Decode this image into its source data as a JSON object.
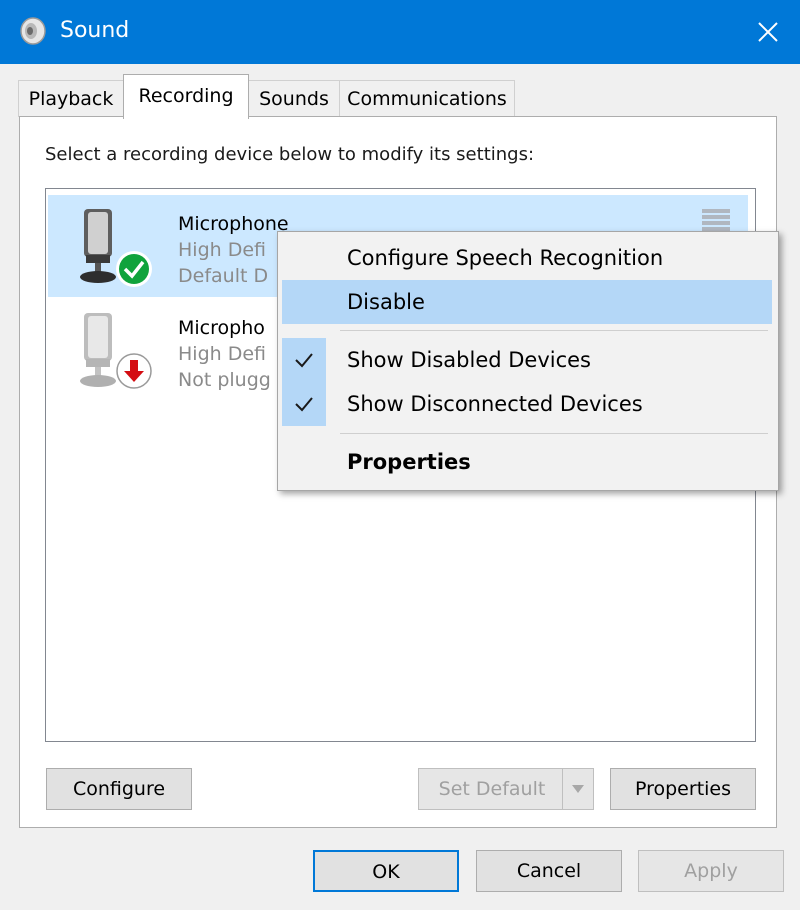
{
  "window": {
    "title": "Sound",
    "title_icon": "speaker-icon",
    "close_icon": "close-icon"
  },
  "tabs": [
    {
      "label": "Playback",
      "active": false
    },
    {
      "label": "Recording",
      "active": true
    },
    {
      "label": "Sounds",
      "active": false
    },
    {
      "label": "Communications",
      "active": false
    }
  ],
  "instruction": "Select a recording device below to modify its settings:",
  "devices": [
    {
      "name": "Microphone",
      "line1": "High Defi",
      "line2": "Default D",
      "status": "default",
      "status_icon": "green-check-icon",
      "selected": true
    },
    {
      "name": "Micropho",
      "line1": "High Defi",
      "line2": "Not plugg",
      "status": "unplugged",
      "status_icon": "red-down-arrow-icon",
      "selected": false
    }
  ],
  "context_menu": {
    "items": [
      {
        "label": "Configure Speech Recognition",
        "checked": false,
        "highlighted": false,
        "bold": false
      },
      {
        "label": "Disable",
        "checked": false,
        "highlighted": true,
        "bold": false
      },
      {
        "label": "Show Disabled Devices",
        "checked": true,
        "highlighted": false,
        "bold": false
      },
      {
        "label": "Show Disconnected Devices",
        "checked": true,
        "highlighted": false,
        "bold": false
      },
      {
        "label": "Properties",
        "checked": false,
        "highlighted": false,
        "bold": true
      }
    ]
  },
  "buttons": {
    "configure": "Configure",
    "set_default": "Set Default",
    "properties": "Properties",
    "ok": "OK",
    "cancel": "Cancel",
    "apply": "Apply"
  },
  "colors": {
    "titlebar": "#0078d7",
    "selection": "#cce8ff",
    "menu_highlight": "#b4d7f7",
    "default_check": "#10a33c",
    "unplugged_arrow": "#d40d12"
  }
}
